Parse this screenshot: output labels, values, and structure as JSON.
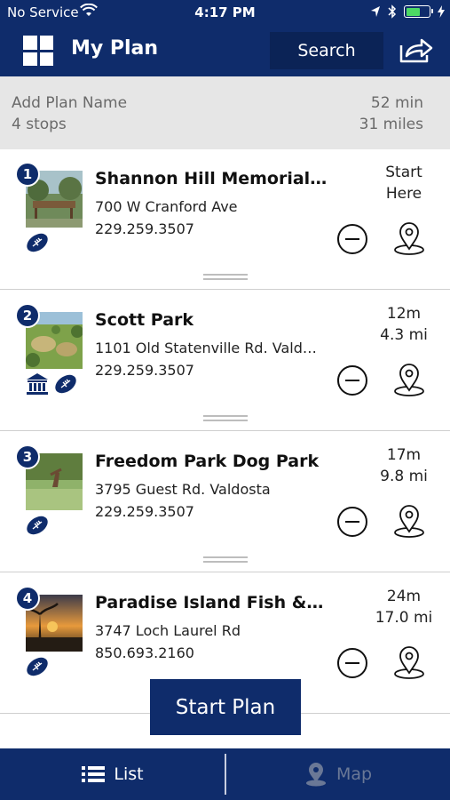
{
  "status_bar": {
    "carrier": "No Service",
    "time": "4:17 PM"
  },
  "nav": {
    "title": "My Plan",
    "search_label": "Search"
  },
  "summary": {
    "plan_name_placeholder": "Add Plan Name",
    "stops": "4 stops",
    "duration": "52 min",
    "distance": "31 miles"
  },
  "stops": [
    {
      "number": "1",
      "name": "Shannon Hill Memorial P...",
      "address": "700 W Cranford Ave",
      "phone": "229.259.3507",
      "meta_line1": "Start",
      "meta_line2": "Here",
      "categories": [
        "football-icon"
      ]
    },
    {
      "number": "2",
      "name": "Scott Park",
      "address": "1101 Old Statenville Rd. Valdo...",
      "phone": "229.259.3507",
      "meta_line1": "12m",
      "meta_line2": "4.3 mi",
      "categories": [
        "museum-icon",
        "football-icon"
      ]
    },
    {
      "number": "3",
      "name": "Freedom Park Dog Park",
      "address": "3795 Guest Rd. Valdosta",
      "phone": "229.259.3507",
      "meta_line1": "17m",
      "meta_line2": "9.8 mi",
      "categories": [
        "football-icon"
      ]
    },
    {
      "number": "4",
      "name": "Paradise Island Fish & R...",
      "address": "3747 Loch Laurel Rd",
      "phone": "850.693.2160",
      "meta_line1": "24m",
      "meta_line2": "17.0 mi",
      "categories": [
        "football-icon"
      ]
    }
  ],
  "start_button_label": "Start Plan",
  "tabs": [
    {
      "label": "List",
      "icon": "list-icon",
      "active": true
    },
    {
      "label": "Map",
      "icon": "map-pin-icon",
      "active": false
    }
  ],
  "colors": {
    "brand_navy": "#0f2c6b",
    "summary_bg": "#e6e6e6",
    "battery_green": "#4cd964"
  }
}
